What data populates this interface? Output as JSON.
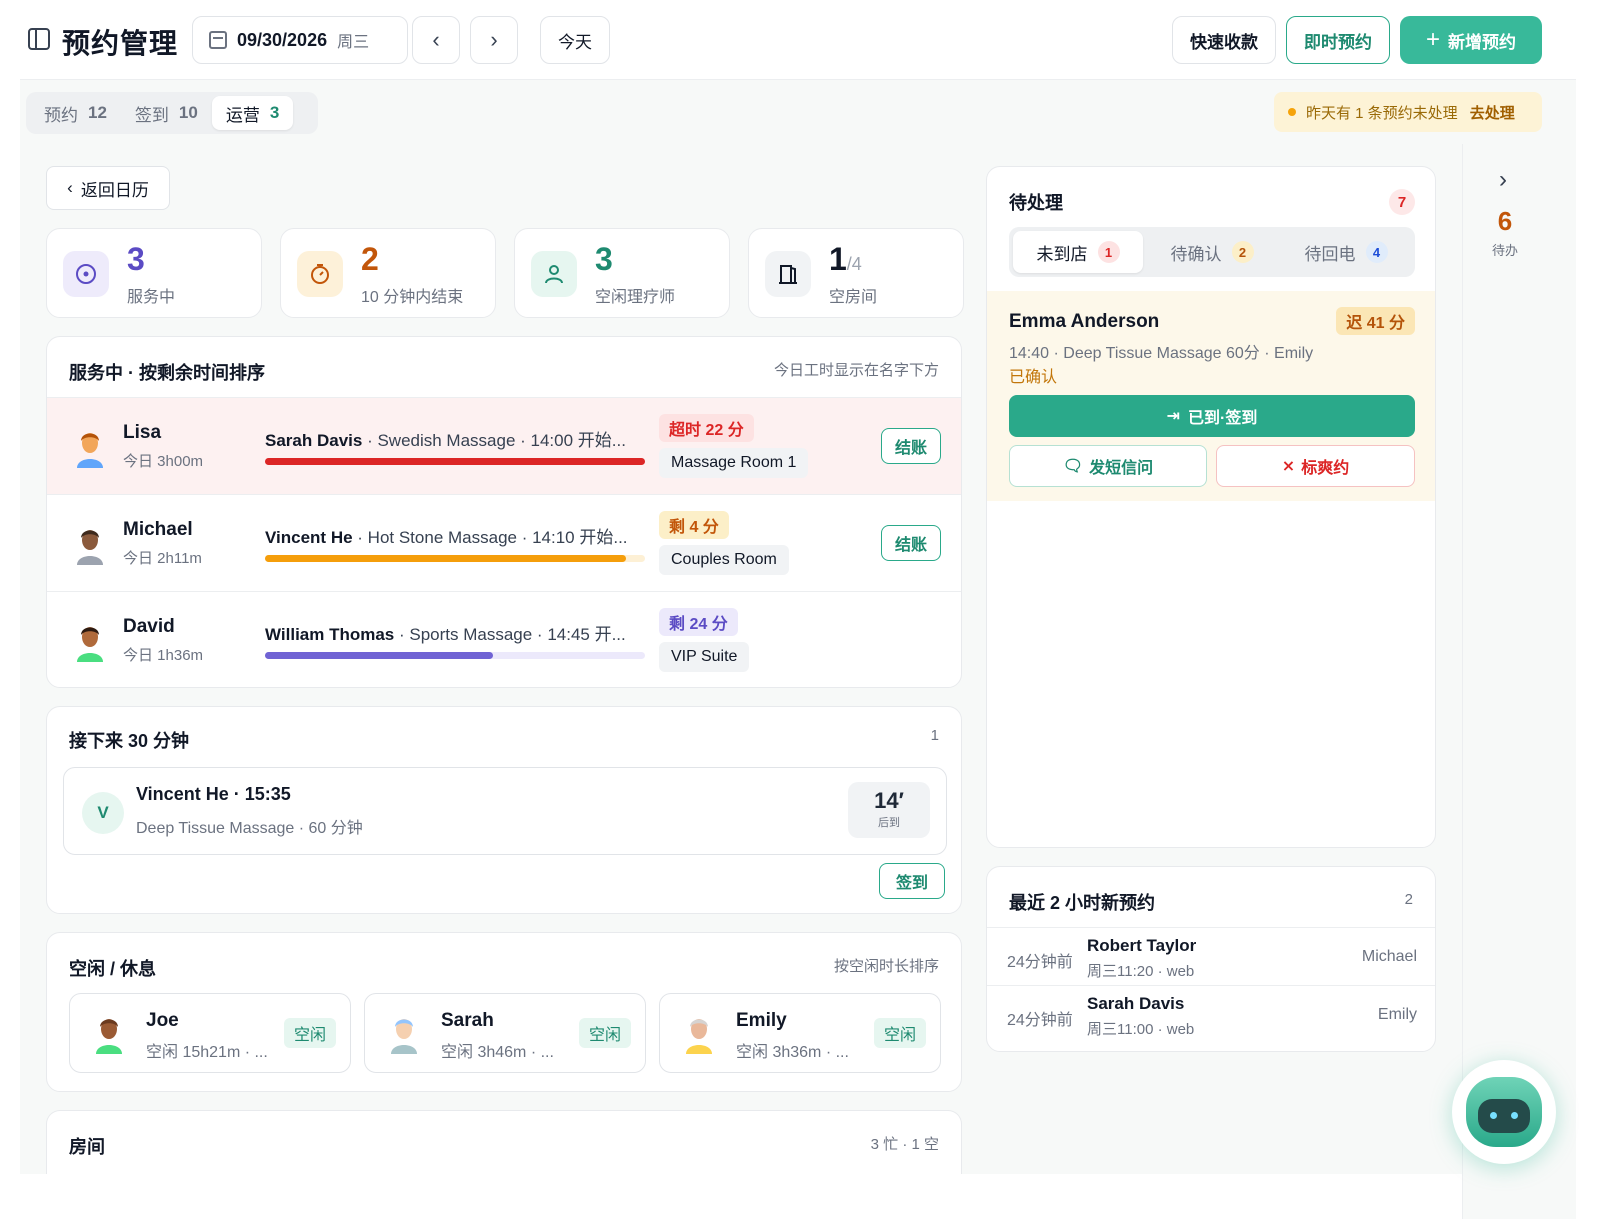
{
  "header": {
    "title": "预约管理",
    "date": "09/30/2026",
    "weekday": "周三",
    "today_label": "今天",
    "quick_pay_label": "快速收款",
    "instant_booking_label": "即时预约",
    "new_booking_label": "新增预约"
  },
  "tabs": [
    {
      "label": "预约",
      "count": "12",
      "active": false
    },
    {
      "label": "签到",
      "count": "10",
      "active": false
    },
    {
      "label": "运营",
      "count": "3",
      "active": true
    }
  ],
  "alert": {
    "text": "昨天有 1 条预约未处理",
    "link": "去处理"
  },
  "back_label": "返回日历",
  "stats": [
    {
      "value": "3",
      "label": "服务中",
      "icon": "radio-icon",
      "color": "#5b4bc4",
      "bg": "#eeebfb"
    },
    {
      "value": "2",
      "label": "10 分钟内结束",
      "icon": "timer-icon",
      "color": "#c2560a",
      "bg": "#fdf1d9"
    },
    {
      "value": "3",
      "label": "空闲理疗师",
      "icon": "user-icon",
      "color": "#1e8a70",
      "bg": "#e6f6f0"
    },
    {
      "value": "1",
      "suffix": "/4",
      "label": "空房间",
      "icon": "door-icon",
      "color": "#111827",
      "bg": "#f1f3f5"
    }
  ],
  "in_service": {
    "title": "服务中 · 按剩余时间排序",
    "meta": "今日工时显示在名字下方",
    "checkout_label": "结账",
    "rows": [
      {
        "therapist": "Lisa",
        "today": "今日 3h00m",
        "client": "Sarah Davis",
        "detail": " · Swedish Massage · 14:00 开始...",
        "badge": "超时 22 分",
        "room": "Massage Room 1",
        "progress": 1.0,
        "bar_color": "#dc2626",
        "track_color": "#fbe0e0",
        "badge_bg": "#fde2e2",
        "badge_color": "#dc2626",
        "overtime": true,
        "checkout": true
      },
      {
        "therapist": "Michael",
        "today": "今日 2h11m",
        "client": "Vincent He",
        "detail": " · Hot Stone Massage · 14:10 开始...",
        "badge": "剩 4 分",
        "room": "Couples Room",
        "progress": 0.95,
        "bar_color": "#f59e0b",
        "track_color": "#fdf0d5",
        "badge_bg": "#fcefc8",
        "badge_color": "#c2560a",
        "overtime": false,
        "checkout": true
      },
      {
        "therapist": "David",
        "today": "今日 1h36m",
        "client": "William Thomas",
        "detail": " · Sports Massage · 14:45 开...",
        "badge": "剩 24 分",
        "room": "VIP Suite",
        "progress": 0.6,
        "bar_color": "#7063d4",
        "track_color": "#ece9fb",
        "badge_bg": "#ece9fb",
        "badge_color": "#5b4bc4",
        "overtime": false,
        "checkout": false
      }
    ]
  },
  "upcoming": {
    "title": "接下来 30 分钟",
    "count": "1",
    "item": {
      "initial": "V",
      "title": "Vincent He · 15:35",
      "sub": "Deep Tissue Massage · 60 分钟",
      "mins": "14′",
      "mins_label": "后到"
    },
    "checkin_label": "签到"
  },
  "idle": {
    "title": "空闲 / 休息",
    "meta": "按空闲时长排序",
    "items": [
      {
        "name": "Joe",
        "sub": "空闲 15h21m · ...",
        "badge": "空闲"
      },
      {
        "name": "Sarah",
        "sub": "空闲 3h46m · ...",
        "badge": "空闲"
      },
      {
        "name": "Emily",
        "sub": "空闲 3h36m · ...",
        "badge": "空闲"
      }
    ]
  },
  "rooms": {
    "title": "房间",
    "meta": "3 忙 · 1 空"
  },
  "pending": {
    "title": "待处理",
    "count": "7",
    "tabs": [
      {
        "label": "未到店",
        "count": "1",
        "active": true,
        "pill_bg": "#fde2e2",
        "pill_color": "#dc2626"
      },
      {
        "label": "待确认",
        "count": "2",
        "active": false,
        "pill_bg": "#fcefc8",
        "pill_color": "#b45309"
      },
      {
        "label": "待回电",
        "count": "4",
        "active": false,
        "pill_bg": "#e0ecfb",
        "pill_color": "#1d4ed8"
      }
    ],
    "item": {
      "name": "Emma Anderson",
      "late": "迟 41 分",
      "desc": "14:40 · Deep Tissue Massage 60分 · Emily",
      "status": "已确认",
      "arrive_label": "已到·签到",
      "sms_label": "发短信问",
      "noshow_label": "标爽约"
    }
  },
  "recent": {
    "title": "最近 2 小时新预约",
    "count": "2",
    "rows": [
      {
        "ago": "24分钟前",
        "name": "Robert Taylor",
        "sub": "周三11:20 · web",
        "therapist": "Michael"
      },
      {
        "ago": "24分钟前",
        "name": "Sarah Davis",
        "sub": "周三11:00 · web",
        "therapist": "Emily"
      }
    ]
  },
  "todo": {
    "count": "6",
    "label": "待办"
  }
}
